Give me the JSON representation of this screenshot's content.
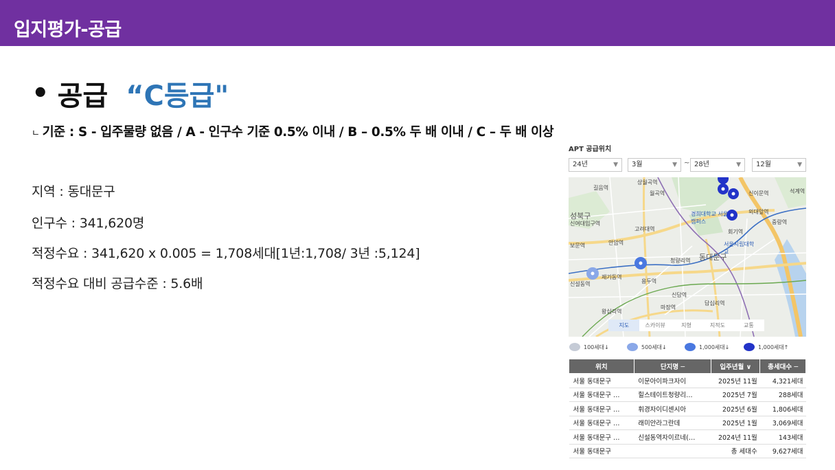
{
  "header": {
    "title": "입지평가-공급"
  },
  "bullet": {
    "dot": "•",
    "label": "공급",
    "grade": "“C등급\""
  },
  "criteria": {
    "mark": "ㄴ",
    "text": "기준 : S - 입주물량 없음 / A - 인구수 기준 0.5% 이내 / B – 0.5% 두 배 이내 / C – 두 배 이상"
  },
  "info": {
    "region": "지역 : 동대문구",
    "population": "인구수 : 341,620명",
    "demand": "적정수요 : 341,620 x 0.005 = 1,708세대[1년:1,708/ 3년 :5,124]",
    "ratio": "적정수요 대비 공급수준 : 5.6배"
  },
  "apt": {
    "title": "APT 공급위치",
    "filters": {
      "start_year": "24년",
      "start_month": "3월",
      "tilde": "~",
      "end_year": "28년",
      "end_month": "12월"
    },
    "map": {
      "labels": {
        "district": "동대문구",
        "seongbuk": "성북구",
        "l1": "길음역",
        "l2": "월곡역",
        "l3": "상월곡역",
        "l4": "신이문역",
        "l5": "석계역",
        "l6": "외대앞역",
        "l7": "경희대학교 서울캠퍼스",
        "l8": "회기역",
        "l9": "중랑역",
        "l10": "신여대입구역",
        "l11": "고려대역",
        "l12": "안암역",
        "l13": "보문역",
        "l14": "서울시립대학교",
        "l15": "청량리역",
        "l16": "용두역",
        "l17": "신답역",
        "l18": "답십리역",
        "l19": "왕십리역",
        "l20": "마장역",
        "l21": "신설동역",
        "l22": "제기동역"
      },
      "tabs": [
        "지도",
        "스카이뷰",
        "지형",
        "지적도",
        "교통"
      ]
    },
    "legend": [
      {
        "label": "100세대↓",
        "color": "#c5cbd6"
      },
      {
        "label": "500세대↓",
        "color": "#8aa8e8"
      },
      {
        "label": "1,000세대↓",
        "color": "#4a78e0"
      },
      {
        "label": "1,000세대↑",
        "color": "#2233c8"
      }
    ],
    "table": {
      "headers": [
        "위치",
        "단지명 ─",
        "입주년월 ∨",
        "총세대수 ─"
      ],
      "rows": [
        [
          "서울 동대문구",
          "이문아이파크자이",
          "2025년 11월",
          "4,321세대"
        ],
        [
          "서울 동대문구 …",
          "힐스테이트청량리…",
          "2025년 7월",
          "288세대"
        ],
        [
          "서울 동대문구 …",
          "휘경자이디센시아",
          "2025년 6월",
          "1,806세대"
        ],
        [
          "서울 동대문구 …",
          "래미안라그란데",
          "2025년 1월",
          "3,069세대"
        ],
        [
          "서울 동대문구 …",
          "신설동역자이르네(…",
          "2024년 11월",
          "143세대"
        ],
        [
          "서울 동대문구",
          "",
          "총 세대수",
          "9,627세대"
        ]
      ]
    }
  }
}
